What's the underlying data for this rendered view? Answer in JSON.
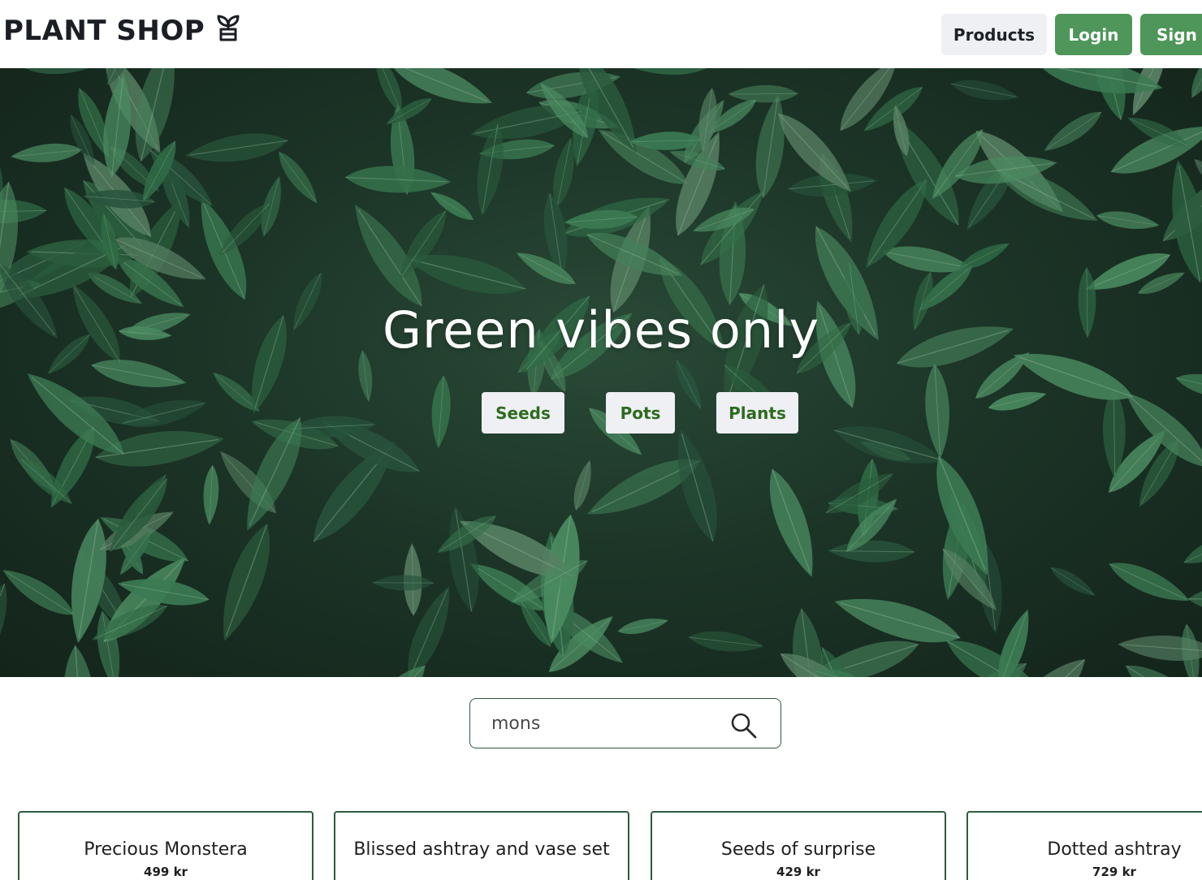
{
  "header": {
    "brand": "PLANT SHOP",
    "brand_icon": "plant-pot-icon",
    "nav": {
      "products_label": "Products",
      "login_label": "Login",
      "signup_label": "Sign Up"
    },
    "colors": {
      "primary": "#4e9659",
      "secondary_bg": "#eef0f3"
    }
  },
  "hero": {
    "title": "Green vibes only",
    "categories": [
      "Seeds",
      "Pots",
      "Plants"
    ],
    "category_text_color": "#2d6b1f"
  },
  "search": {
    "value": "mons",
    "icon": "search-icon"
  },
  "products": [
    {
      "name": "Precious Monstera",
      "price": "499 kr"
    },
    {
      "name": "Blissed ashtray and vase set",
      "price": ""
    },
    {
      "name": "Seeds of surprise",
      "price": "429 kr"
    },
    {
      "name": "Dotted ashtray",
      "price": "729 kr"
    }
  ]
}
